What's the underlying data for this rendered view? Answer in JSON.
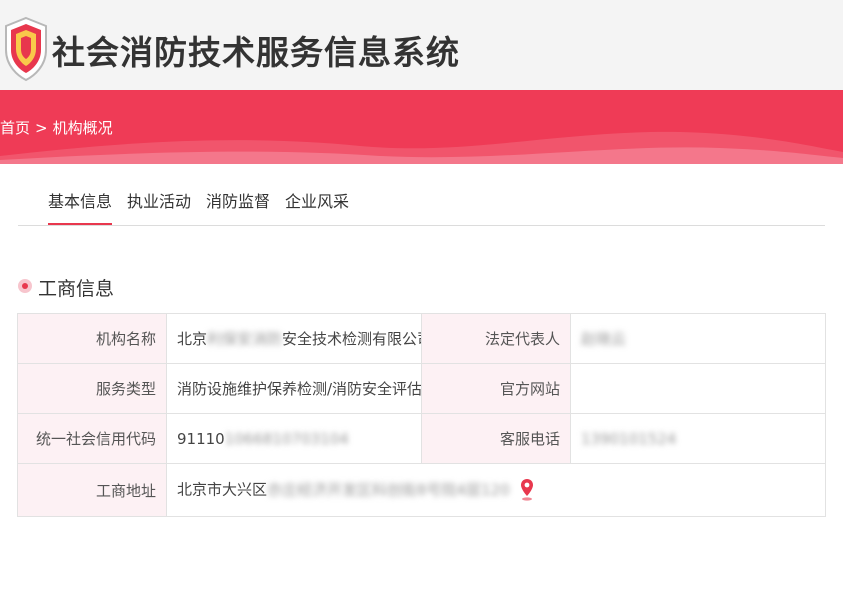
{
  "header": {
    "title": "社会消防技术服务信息系统"
  },
  "breadcrumb": {
    "home": "首页",
    "separator": ">",
    "current": "机构概况"
  },
  "tabs": [
    {
      "label": "基本信息",
      "active": true
    },
    {
      "label": "执业活动",
      "active": false
    },
    {
      "label": "消防监督",
      "active": false
    },
    {
      "label": "企业风采",
      "active": false
    }
  ],
  "section": {
    "title": "工商信息"
  },
  "info": {
    "org_name_label": "机构名称",
    "org_name_prefix": "北京",
    "org_name_hidden": "利保安消防",
    "org_name_suffix": "安全技术检测有限公司",
    "legal_rep_label": "法定代表人",
    "legal_rep_value": "赵晓云",
    "service_type_label": "服务类型",
    "service_type_value": "消防设施维护保养检测/消防安全评估",
    "website_label": "官方网站",
    "website_value": "",
    "credit_code_label": "统一社会信用代码",
    "credit_code_prefix": "91110",
    "credit_code_hidden": "1066810703104",
    "phone_label": "客服电话",
    "phone_value": "1390101524",
    "address_label": "工商地址",
    "address_prefix": "北京市大兴区",
    "address_hidden": "亦庄经济开发区科创街8号院4层120"
  },
  "icons": {
    "logo": "shield-logo-icon",
    "location": "location-pin-icon"
  },
  "colors": {
    "brand_red": "#ef3b56",
    "tab_underline": "#e8374d",
    "label_bg": "#fdf1f4"
  }
}
